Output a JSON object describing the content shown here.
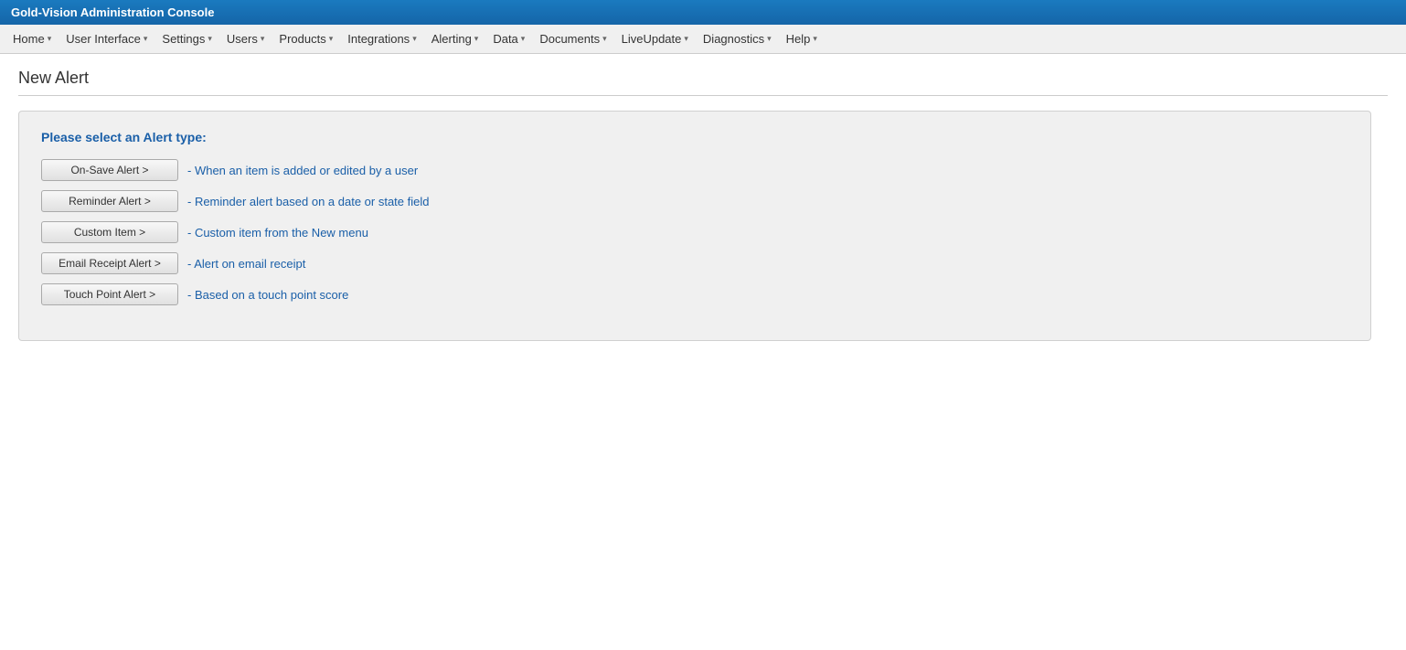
{
  "app": {
    "banner_title": "Gold-Vision Administration Console"
  },
  "nav": {
    "items": [
      {
        "label": "Home",
        "arrow": "▾"
      },
      {
        "label": "User Interface",
        "arrow": "▾"
      },
      {
        "label": "Settings",
        "arrow": "▾"
      },
      {
        "label": "Users",
        "arrow": "▾"
      },
      {
        "label": "Products",
        "arrow": "▾"
      },
      {
        "label": "Integrations",
        "arrow": "▾"
      },
      {
        "label": "Alerting",
        "arrow": "▾"
      },
      {
        "label": "Data",
        "arrow": "▾"
      },
      {
        "label": "Documents",
        "arrow": "▾"
      },
      {
        "label": "LiveUpdate",
        "arrow": "▾"
      },
      {
        "label": "Diagnostics",
        "arrow": "▾"
      },
      {
        "label": "Help",
        "arrow": "▾"
      }
    ]
  },
  "page": {
    "title": "New Alert",
    "panel_prompt": "Please select an Alert type:",
    "alert_types": [
      {
        "button_label": "On-Save Alert >",
        "description": "- When an item is added or edited by a user"
      },
      {
        "button_label": "Reminder Alert >",
        "description": "- Reminder alert based on a date or state field"
      },
      {
        "button_label": "Custom Item >",
        "description": "- Custom item from the New menu"
      },
      {
        "button_label": "Email Receipt Alert >",
        "description": "- Alert on email receipt"
      },
      {
        "button_label": "Touch Point Alert >",
        "description": "- Based on a touch point score"
      }
    ]
  }
}
